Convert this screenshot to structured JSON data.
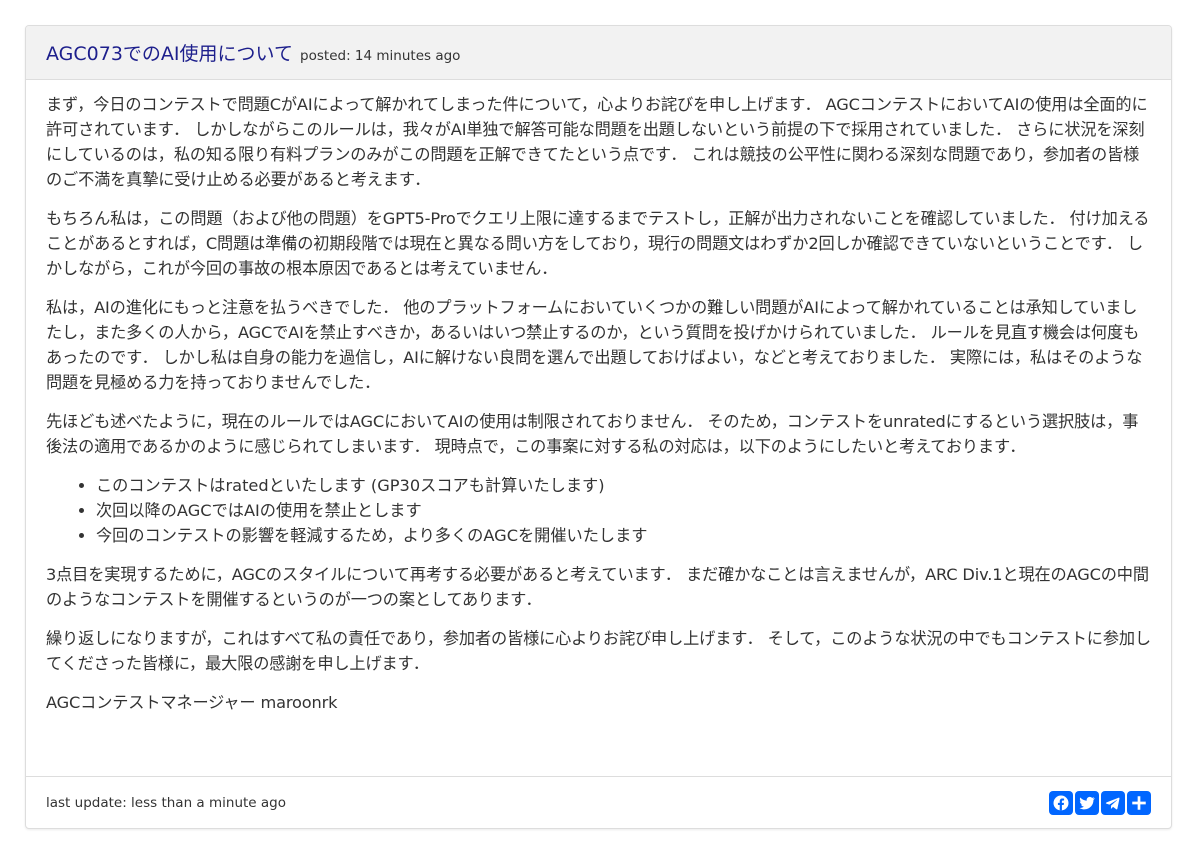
{
  "post": {
    "title": "AGC073でのAI使用について",
    "posted": "posted: 14 minutes ago",
    "paragraphs": [
      "まず，今日のコンテストで問題CがAIによって解かれてしまった件について，心よりお詫びを申し上げます． AGCコンテストにおいてAIの使用は全面的に許可されています． しかしながらこのルールは，我々がAI単独で解答可能な問題を出題しないという前提の下で採用されていました． さらに状況を深刻にしているのは，私の知る限り有料プランのみがこの問題を正解できてたという点です． これは競技の公平性に関わる深刻な問題であり，参加者の皆様のご不満を真摯に受け止める必要があると考えます．",
      "もちろん私は，この問題（および他の問題）をGPT5-Proでクエリ上限に達するまでテストし，正解が出力されないことを確認していました． 付け加えることがあるとすれば，C問題は準備の初期段階では現在と異なる問い方をしており，現行の問題文はわずか2回しか確認できていないということです． しかしながら，これが今回の事故の根本原因であるとは考えていません．",
      "私は，AIの進化にもっと注意を払うべきでした． 他のプラットフォームにおいていくつかの難しい問題がAIによって解かれていることは承知していましたし，また多くの人から，AGCでAIを禁止すべきか，あるいはいつ禁止するのか，という質問を投げかけられていました． ルールを見直す機会は何度もあったのです． しかし私は自身の能力を過信し，AIに解けない良問を選んで出題しておけばよい，などと考えておりました． 実際には，私はそのような問題を見極める力を持っておりませんでした．",
      "先ほども述べたように，現在のルールではAGCにおいてAIの使用は制限されておりません． そのため，コンテストをunratedにするという選択肢は，事後法の適用であるかのように感じられてしまいます． 現時点で，この事案に対する私の対応は，以下のようにしたいと考えております．"
    ],
    "bullets": [
      "このコンテストはratedといたします (GP30スコアも計算いたします)",
      "次回以降のAGCではAIの使用を禁止とします",
      "今回のコンテストの影響を軽減するため，より多くのAGCを開催いたします"
    ],
    "paragraphs_after": [
      "3点目を実現するために，AGCのスタイルについて再考する必要があると考えています． まだ確かなことは言えませんが，ARC Div.1と現在のAGCの中間のようなコンテストを開催するというのが一つの案としてあります．",
      "繰り返しになりますが，これはすべて私の責任であり，参加者の皆様に心よりお詫び申し上げます． そして，このような状況の中でもコンテストに参加してくださった皆様に，最大限の感謝を申し上げます．"
    ],
    "signature": "AGCコンテストマネージャー maroonrk",
    "last_update": "last update: less than a minute ago"
  },
  "share": {
    "icons": [
      "facebook-icon",
      "twitter-icon",
      "telegram-icon",
      "share-plus-icon"
    ],
    "color": "#0166ff"
  },
  "colors": {
    "title": "#1d1f8c",
    "heading_bg": "#f2f2f2",
    "border": "#dddddd",
    "text": "#333333"
  }
}
